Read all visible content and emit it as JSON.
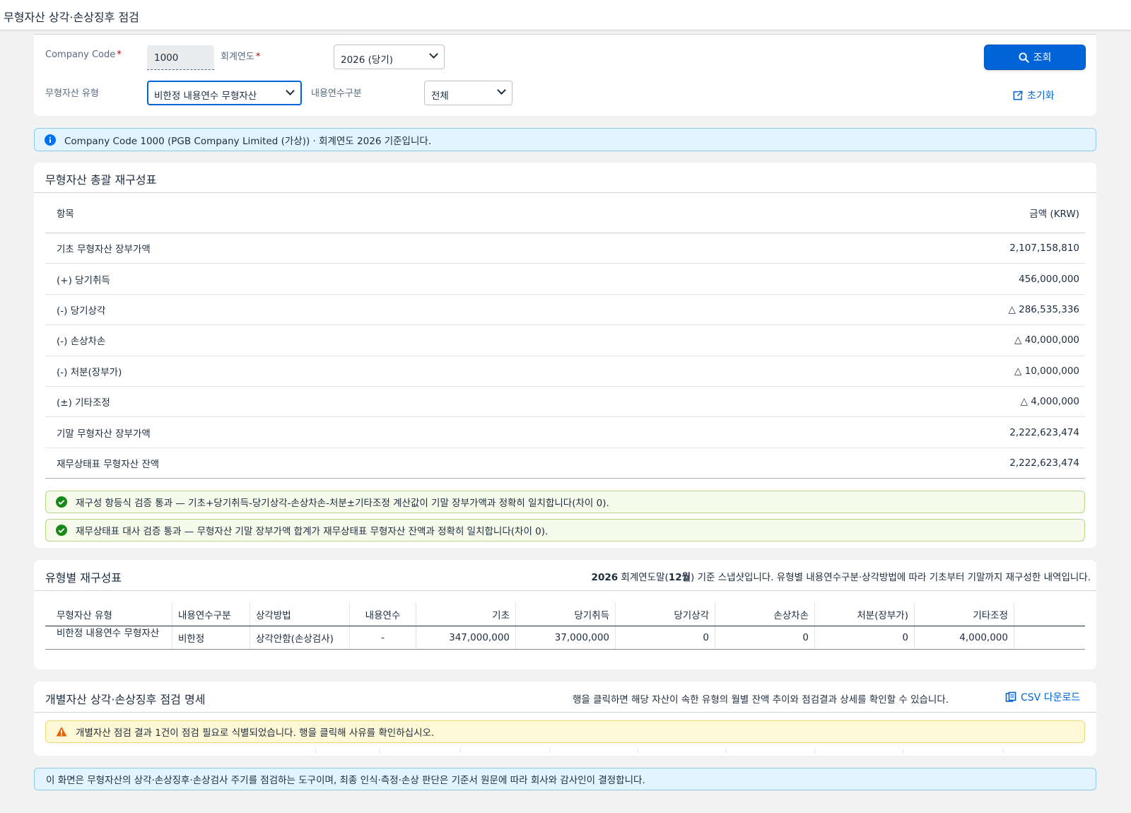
{
  "app": {
    "title": "무형자산 상각·손상징후 점검"
  },
  "filter": {
    "company_code_label": "Company Code",
    "company_code_value": "1000",
    "fiscal_year_label": "회계연도",
    "fiscal_year_value": "2026 (당기)",
    "asset_type_label": "무형자산 유형",
    "asset_type_value": "비한정 내용연수 무형자산",
    "useful_life_label": "내용연수구분",
    "useful_life_value": "전체",
    "search_button": "조회",
    "reset_button": "초기화",
    "required_mark": "*"
  },
  "info_message": "Company Code 1000 (PGB Company Limited (가상)) · 회계연도 2026 기준입니다.",
  "recon": {
    "title": "무형자산 총괄 재구성표",
    "col_item": "항목",
    "col_amount": "금액 (KRW)",
    "rows": [
      {
        "item": "기초 무형자산 장부가액",
        "amount": "2,107,158,810"
      },
      {
        "item": "(+) 당기취득",
        "amount": "456,000,000"
      },
      {
        "item": "(-) 당기상각",
        "amount": "△ 286,535,336"
      },
      {
        "item": "(-) 손상차손",
        "amount": "△ 40,000,000"
      },
      {
        "item": "(-) 처분(장부가)",
        "amount": "△ 10,000,000"
      },
      {
        "item": "(±) 기타조정",
        "amount": "△ 4,000,000"
      },
      {
        "item": "기말 무형자산 장부가액",
        "amount": "2,222,623,474"
      },
      {
        "item": "재무상태표 무형자산 잔액",
        "amount": "2,222,623,474"
      }
    ],
    "check1": "재구성 항등식 검증 통과 — 기초+당기취득-당기상각-손상차손-처분±기타조정 계산값이 기말 장부가액과 정확히 일치합니다(차이 0).",
    "check2": "재무상태표 대사 검증 통과 — 무형자산 기말 장부가액 합계가 재무상태표 무형자산 잔액과 정확히 일치합니다(차이 0)."
  },
  "type_table": {
    "title": "유형별 재구성표",
    "note_year": "2026",
    "note_mid": " 회계연도말(",
    "note_month": "12월",
    "note_rest": ") 기준 스냅샷입니다. 유형별 내용연수구분·상각방법에 따라 기초부터 기말까지 재구성한 내역입니다.",
    "headers": [
      "무형자산 유형",
      "내용연수구분",
      "상각방법",
      "내용연수",
      "기초",
      "당기취득",
      "당기상각",
      "손상차손",
      "처분(장부가)",
      "기타조정"
    ],
    "rows": [
      [
        "비한정 내용연수 무형자산",
        "비한정",
        "상각안함(손상검사)",
        "-",
        "347,000,000",
        "37,000,000",
        "0",
        "0",
        "0",
        "4,000,000"
      ]
    ]
  },
  "detail": {
    "title": "개별자산 상각·손상징후 점검 명세",
    "hint": "행을 클릭하면 해당 자산이 속한 유형의 월별 잔액 추이와 점검결과 상세를 확인할 수 있습니다.",
    "csv_button": "CSV 다운로드",
    "warning": "개별자산 점검 결과 1건이 점검 필요로 식별되었습니다. 행을 클릭해 사유를 확인하십시오."
  },
  "footer_note": "이 화면은 무형자산의 상각·손상징후·손상검사 주기를 점검하는 도구이며, 최종 인식·측정·손상 판단은 기준서 원문에 따라 회사와 감사인이 결정합니다.",
  "colors": {
    "accent": "#0064d9",
    "success": "#188918",
    "warning": "#e76500",
    "info": "#0070f2"
  }
}
